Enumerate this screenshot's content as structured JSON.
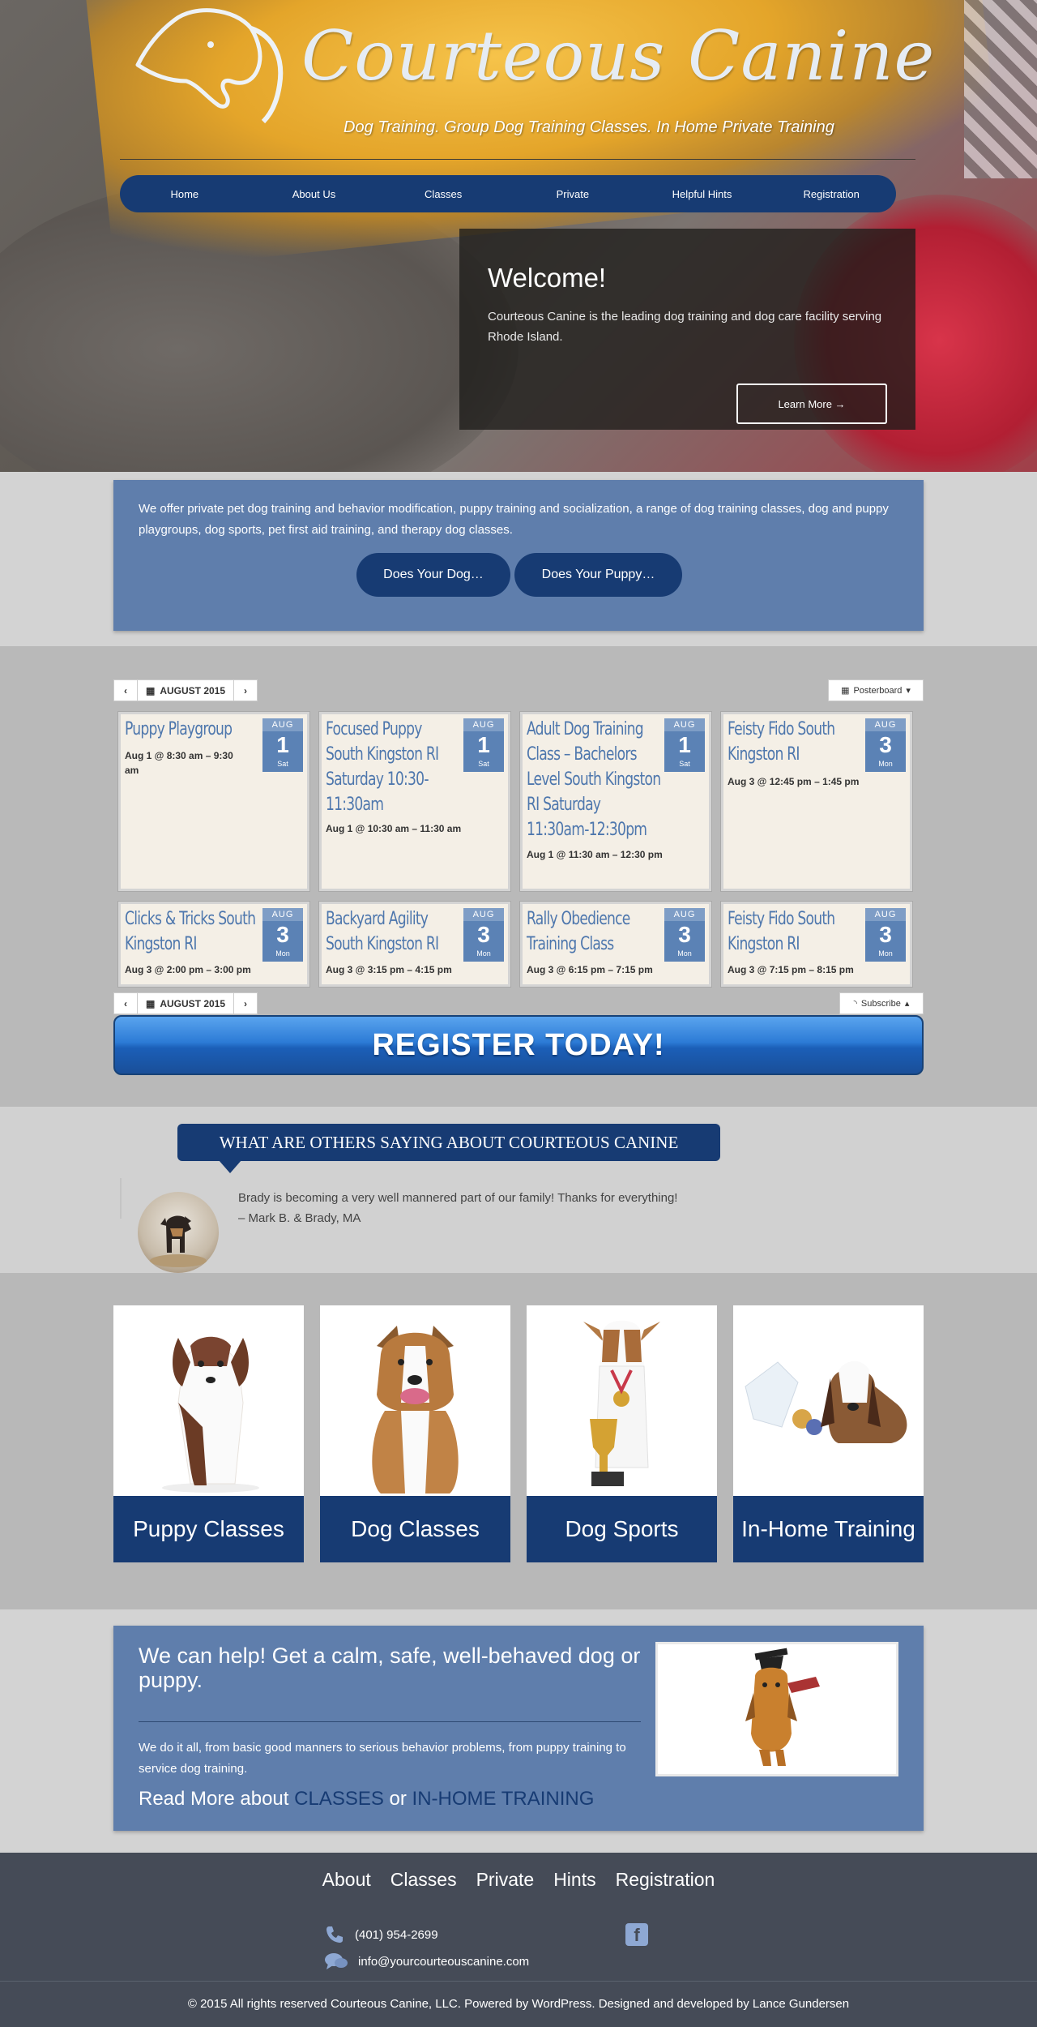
{
  "brand": {
    "name": "Courteous Canine",
    "tagline": "Dog Training. Group Dog Training Classes. In Home Private Training"
  },
  "nav": [
    "Home",
    "About Us",
    "Classes",
    "Private",
    "Helpful Hints",
    "Registration"
  ],
  "welcome": {
    "title": "Welcome!",
    "text": "Courteous Canine is the leading dog training and dog care facility serving Rhode Island.",
    "button": "Learn More →"
  },
  "intro": {
    "text": "We offer private pet dog training and behavior modification, puppy training and socialization, a range of dog training classes, dog and puppy playgroups, dog sports, pet first aid training, and therapy dog classes.",
    "buttons": [
      "Does Your Dog…",
      "Does Your Puppy…"
    ]
  },
  "calendar": {
    "month": "AUGUST 2015",
    "view_label": "Posterboard",
    "subscribe_label": "Subscribe",
    "events": [
      {
        "title": "Puppy Playgroup",
        "when": "Aug 1 @ 8:30 am – 9:30 am",
        "month": "AUG",
        "day": "1",
        "weekday": "Sat"
      },
      {
        "title": "Focused Puppy South Kingston RI Saturday 10:30-11:30am",
        "when": "Aug 1 @ 10:30 am – 11:30 am",
        "month": "AUG",
        "day": "1",
        "weekday": "Sat"
      },
      {
        "title": "Adult Dog Training Class – Bachelors Level South Kingston RI Saturday 11:30am-12:30pm",
        "when": "Aug 1 @ 11:30 am – 12:30 pm",
        "month": "AUG",
        "day": "1",
        "weekday": "Sat"
      },
      {
        "title": "Feisty Fido South Kingston RI",
        "when": "Aug 3 @ 12:45 pm – 1:45 pm",
        "month": "AUG",
        "day": "3",
        "weekday": "Mon"
      },
      {
        "title": "Clicks & Tricks South Kingston RI",
        "when": "Aug 3 @ 2:00 pm – 3:00 pm",
        "month": "AUG",
        "day": "3",
        "weekday": "Mon"
      },
      {
        "title": "Backyard Agility South Kingston RI",
        "when": "Aug 3 @ 3:15 pm – 4:15 pm",
        "month": "AUG",
        "day": "3",
        "weekday": "Mon"
      },
      {
        "title": "Rally Obedience Training Class",
        "when": "Aug 3 @ 6:15 pm – 7:15 pm",
        "month": "AUG",
        "day": "3",
        "weekday": "Mon"
      },
      {
        "title": "Feisty Fido South Kingston RI",
        "when": "Aug 3 @ 7:15 pm – 8:15 pm",
        "month": "AUG",
        "day": "3",
        "weekday": "Mon"
      }
    ]
  },
  "register_button": "REGISTER TODAY!",
  "testimonial": {
    "heading": "WHAT ARE OTHERS SAYING ABOUT COURTEOUS CANINE",
    "quote": "Brady is becoming a very well mannered part of our family! Thanks for everything!",
    "author": "– Mark B. & Brady, MA"
  },
  "class_cards": [
    "Puppy Classes",
    "Dog Classes",
    "Dog Sports",
    "In-Home Training"
  ],
  "help": {
    "heading": "We can help! Get a calm, safe, well-behaved dog or puppy.",
    "text": "We do it all, from basic good manners to serious behavior problems, from puppy training to service dog training.",
    "read_more_prefix": "Read More about",
    "classes_link": "CLASSES",
    "or": "or",
    "inhome_link": "IN-HOME TRAINING"
  },
  "footer": {
    "nav": [
      "About",
      "Classes",
      "Private",
      "Hints",
      "Registration"
    ],
    "phone": "(401) 954-2699",
    "email": "info@yourcourteouscanine.com",
    "copyright": "© 2015 All rights reserved Courteous Canine, LLC. Powered by WordPress. Designed and developed by Lance Gundersen"
  },
  "colors": {
    "navy": "#173b73",
    "panel_blue": "#5f7eac",
    "event_title": "#4e77ad",
    "footer": "#454b57"
  }
}
